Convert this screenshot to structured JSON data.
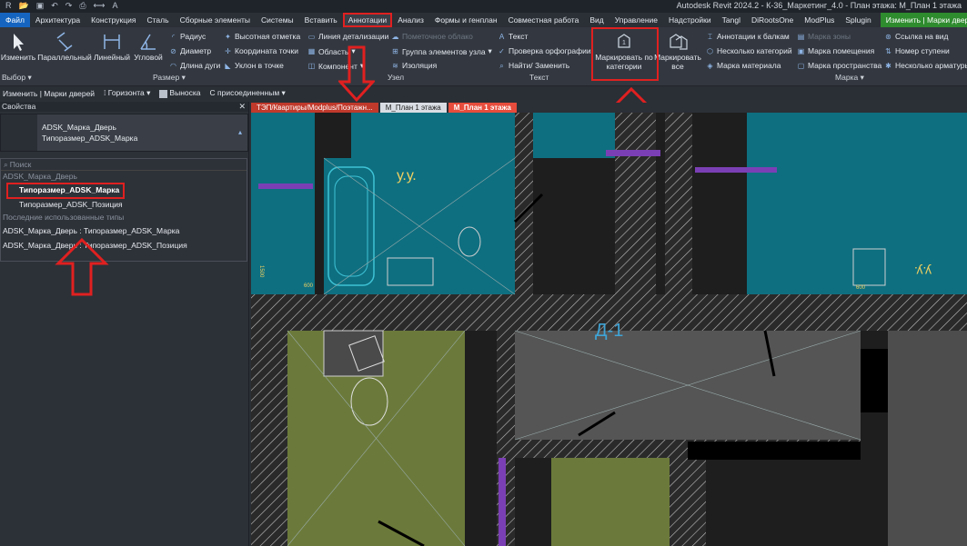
{
  "title": "Autodesk Revit 2024.2 - К-36_Маркетинг_4.0 - План этажа: М_План 1 этажа",
  "qat_icons": [
    "home-icon",
    "open-icon",
    "save-icon",
    "undo-icon",
    "redo-icon",
    "print-icon",
    "measure-icon",
    "text-icon"
  ],
  "menu": [
    "Файл",
    "Архитектура",
    "Конструкция",
    "Сталь",
    "Сборные элементы",
    "Системы",
    "Вставить",
    "Аннотации",
    "Анализ",
    "Формы и генплан",
    "Совместная работа",
    "Вид",
    "Управление",
    "Надстройки",
    "Tangl",
    "DiRootsOne",
    "ModPlus",
    "Splugin",
    "Изменить | Марки дверей"
  ],
  "menu_active_index": 7,
  "ribbon": {
    "modify": "Изменить",
    "dims": [
      "Параллельный",
      "Линейный",
      "Угловой"
    ],
    "dims_small": [
      "Радиус",
      "Диаметр",
      "Длина дуги",
      "Высотная отметка",
      "Координата точки",
      "Уклон в точке"
    ],
    "detail": [
      "Линия детализации",
      "Область",
      "Компонент",
      "Пометочное облако",
      "Группа элементов узла",
      "Изоляция"
    ],
    "text": [
      "Текст",
      "Проверка орфографии",
      "Найти/ Заменить"
    ],
    "tag_by_category": "Маркировать по категории",
    "tag_all": "Маркировать все",
    "tag_small": [
      "Аннотации к балкам",
      "Несколько категорий",
      "Марка материала",
      "Марка зоны",
      "Марка помещения",
      "Марка пространства",
      "Ссылка на вид",
      "Номер ступени",
      "Несколько арматуры"
    ],
    "panels": [
      "Выбор",
      "Размер",
      "Узел",
      "Текст",
      "Марка"
    ]
  },
  "optbar": {
    "context": "Изменить | Марки дверей",
    "orientation": "Горизонта",
    "leader_label": "Выноска",
    "leader_checked": true,
    "attach": "С присоединенным"
  },
  "properties": {
    "header": "Свойства",
    "type_family": "ADSK_Марка_Дверь",
    "type_name": "Типоразмер_ADSK_Марка",
    "search_placeholder": "Поиск",
    "group": "ADSK_Марка_Дверь",
    "items": [
      "Типоразмер_ADSK_Марка",
      "Типоразмер_ADSK_Позиция"
    ],
    "recent_label": "Последние использованные типы",
    "recent": [
      "ADSK_Марка_Дверь : Типоразмер_ADSK_Марка",
      "ADSK_Марка_Дверь : Типоразмер_ADSK_Позиция"
    ]
  },
  "view_tabs": [
    "ТЭП/Квартиры/Modplus/Поэтажн...",
    "М_План 1 этажа",
    "М_План 1 этажа"
  ],
  "plan_labels": {
    "room1": "у.у.",
    "room2": "у.у.",
    "door_tag": "Д-1",
    "dim600a": "600",
    "dim600b": "600",
    "dim1500": "1500"
  },
  "colors": {
    "teal": "#0e6f80",
    "olive": "#6b7a3a",
    "gray": "#5a5a5a",
    "highlight": "#e02020",
    "purple": "#7b3fb5",
    "cyan": "#3fc3d6"
  }
}
